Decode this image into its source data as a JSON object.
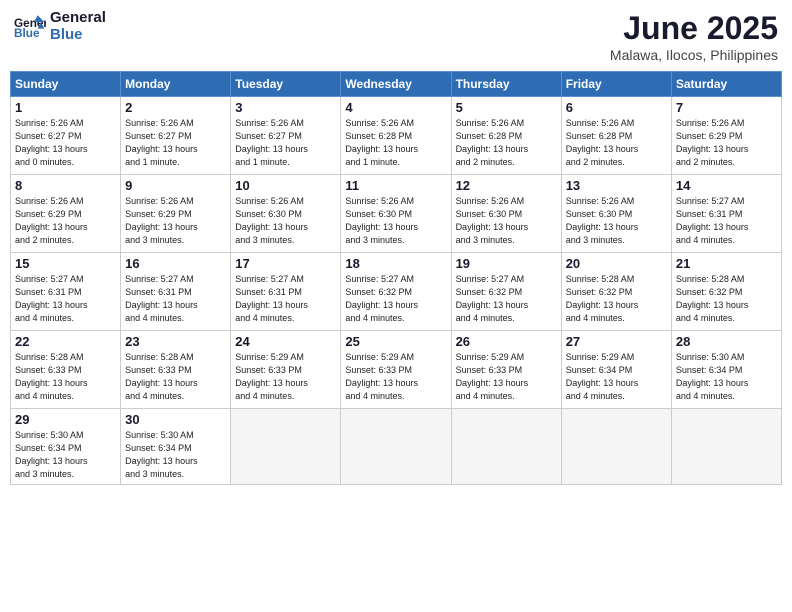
{
  "header": {
    "logo_line1": "General",
    "logo_line2": "Blue",
    "month_year": "June 2025",
    "location": "Malawa, Ilocos, Philippines"
  },
  "weekdays": [
    "Sunday",
    "Monday",
    "Tuesday",
    "Wednesday",
    "Thursday",
    "Friday",
    "Saturday"
  ],
  "weeks": [
    [
      {
        "day": "1",
        "info": "Sunrise: 5:26 AM\nSunset: 6:27 PM\nDaylight: 13 hours\nand 0 minutes."
      },
      {
        "day": "2",
        "info": "Sunrise: 5:26 AM\nSunset: 6:27 PM\nDaylight: 13 hours\nand 1 minute."
      },
      {
        "day": "3",
        "info": "Sunrise: 5:26 AM\nSunset: 6:27 PM\nDaylight: 13 hours\nand 1 minute."
      },
      {
        "day": "4",
        "info": "Sunrise: 5:26 AM\nSunset: 6:28 PM\nDaylight: 13 hours\nand 1 minute."
      },
      {
        "day": "5",
        "info": "Sunrise: 5:26 AM\nSunset: 6:28 PM\nDaylight: 13 hours\nand 2 minutes."
      },
      {
        "day": "6",
        "info": "Sunrise: 5:26 AM\nSunset: 6:28 PM\nDaylight: 13 hours\nand 2 minutes."
      },
      {
        "day": "7",
        "info": "Sunrise: 5:26 AM\nSunset: 6:29 PM\nDaylight: 13 hours\nand 2 minutes."
      }
    ],
    [
      {
        "day": "8",
        "info": "Sunrise: 5:26 AM\nSunset: 6:29 PM\nDaylight: 13 hours\nand 2 minutes."
      },
      {
        "day": "9",
        "info": "Sunrise: 5:26 AM\nSunset: 6:29 PM\nDaylight: 13 hours\nand 3 minutes."
      },
      {
        "day": "10",
        "info": "Sunrise: 5:26 AM\nSunset: 6:30 PM\nDaylight: 13 hours\nand 3 minutes."
      },
      {
        "day": "11",
        "info": "Sunrise: 5:26 AM\nSunset: 6:30 PM\nDaylight: 13 hours\nand 3 minutes."
      },
      {
        "day": "12",
        "info": "Sunrise: 5:26 AM\nSunset: 6:30 PM\nDaylight: 13 hours\nand 3 minutes."
      },
      {
        "day": "13",
        "info": "Sunrise: 5:26 AM\nSunset: 6:30 PM\nDaylight: 13 hours\nand 3 minutes."
      },
      {
        "day": "14",
        "info": "Sunrise: 5:27 AM\nSunset: 6:31 PM\nDaylight: 13 hours\nand 4 minutes."
      }
    ],
    [
      {
        "day": "15",
        "info": "Sunrise: 5:27 AM\nSunset: 6:31 PM\nDaylight: 13 hours\nand 4 minutes."
      },
      {
        "day": "16",
        "info": "Sunrise: 5:27 AM\nSunset: 6:31 PM\nDaylight: 13 hours\nand 4 minutes."
      },
      {
        "day": "17",
        "info": "Sunrise: 5:27 AM\nSunset: 6:31 PM\nDaylight: 13 hours\nand 4 minutes."
      },
      {
        "day": "18",
        "info": "Sunrise: 5:27 AM\nSunset: 6:32 PM\nDaylight: 13 hours\nand 4 minutes."
      },
      {
        "day": "19",
        "info": "Sunrise: 5:27 AM\nSunset: 6:32 PM\nDaylight: 13 hours\nand 4 minutes."
      },
      {
        "day": "20",
        "info": "Sunrise: 5:28 AM\nSunset: 6:32 PM\nDaylight: 13 hours\nand 4 minutes."
      },
      {
        "day": "21",
        "info": "Sunrise: 5:28 AM\nSunset: 6:32 PM\nDaylight: 13 hours\nand 4 minutes."
      }
    ],
    [
      {
        "day": "22",
        "info": "Sunrise: 5:28 AM\nSunset: 6:33 PM\nDaylight: 13 hours\nand 4 minutes."
      },
      {
        "day": "23",
        "info": "Sunrise: 5:28 AM\nSunset: 6:33 PM\nDaylight: 13 hours\nand 4 minutes."
      },
      {
        "day": "24",
        "info": "Sunrise: 5:29 AM\nSunset: 6:33 PM\nDaylight: 13 hours\nand 4 minutes."
      },
      {
        "day": "25",
        "info": "Sunrise: 5:29 AM\nSunset: 6:33 PM\nDaylight: 13 hours\nand 4 minutes."
      },
      {
        "day": "26",
        "info": "Sunrise: 5:29 AM\nSunset: 6:33 PM\nDaylight: 13 hours\nand 4 minutes."
      },
      {
        "day": "27",
        "info": "Sunrise: 5:29 AM\nSunset: 6:34 PM\nDaylight: 13 hours\nand 4 minutes."
      },
      {
        "day": "28",
        "info": "Sunrise: 5:30 AM\nSunset: 6:34 PM\nDaylight: 13 hours\nand 4 minutes."
      }
    ],
    [
      {
        "day": "29",
        "info": "Sunrise: 5:30 AM\nSunset: 6:34 PM\nDaylight: 13 hours\nand 3 minutes."
      },
      {
        "day": "30",
        "info": "Sunrise: 5:30 AM\nSunset: 6:34 PM\nDaylight: 13 hours\nand 3 minutes."
      },
      null,
      null,
      null,
      null,
      null
    ]
  ]
}
